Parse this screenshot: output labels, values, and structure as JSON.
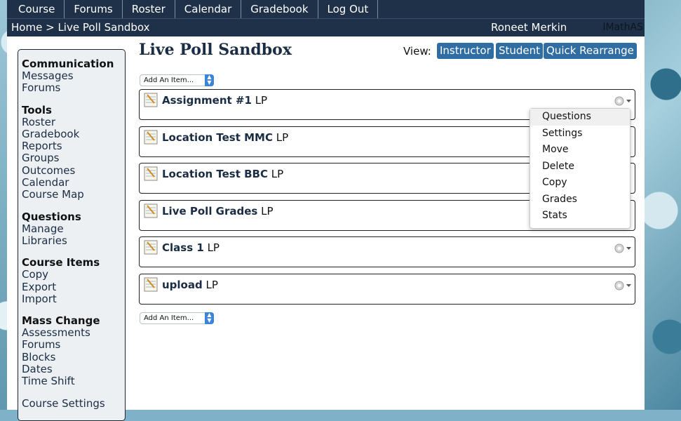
{
  "topnav": [
    "Course",
    "Forums",
    "Roster",
    "Calendar",
    "Gradebook",
    "Log Out"
  ],
  "breadcrumb": {
    "home": "Home",
    "separator": ">",
    "current": "Live Poll Sandbox"
  },
  "user": {
    "name": "Roneet Merkin"
  },
  "brand": "IMathAS",
  "sidebar": [
    {
      "heading": "Communication",
      "links": [
        "Messages",
        "Forums"
      ]
    },
    {
      "heading": "Tools",
      "links": [
        "Roster",
        "Gradebook",
        "Reports",
        "Groups",
        "Outcomes",
        "Calendar",
        "Course Map"
      ]
    },
    {
      "heading": "Questions",
      "links": [
        "Manage",
        "Libraries"
      ]
    },
    {
      "heading": "Course Items",
      "links": [
        "Copy",
        "Export",
        "Import"
      ]
    },
    {
      "heading": "Mass Change",
      "links": [
        "Assessments",
        "Forums",
        "Blocks",
        "Dates",
        "Time Shift"
      ]
    },
    {
      "heading": "",
      "links": [
        "Course Settings"
      ]
    }
  ],
  "main": {
    "title": "Live Poll Sandbox",
    "view_label": "View:",
    "view_buttons": [
      "Instructor",
      "Student",
      "Quick Rearrange"
    ],
    "add_item_label": "Add An Item...",
    "items": [
      {
        "name": "Assignment #1",
        "tag": "LP"
      },
      {
        "name": "Location Test MMC",
        "tag": "LP"
      },
      {
        "name": "Location Test BBC",
        "tag": "LP"
      },
      {
        "name": "Live Poll Grades",
        "tag": "LP"
      },
      {
        "name": "Class 1",
        "tag": "LP"
      },
      {
        "name": "upload",
        "tag": "LP"
      }
    ]
  },
  "dropdown_menu": [
    "Questions",
    "Settings",
    "Move",
    "Delete",
    "Copy",
    "Grades",
    "Stats"
  ]
}
